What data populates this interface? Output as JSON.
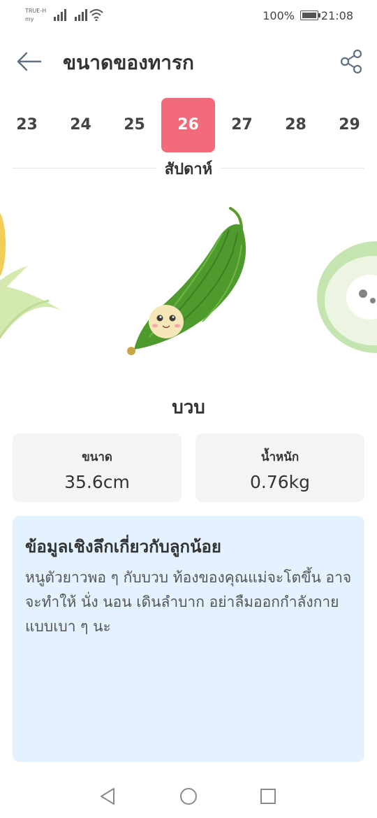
{
  "status_bar": {
    "carrier_line1": "TRUE-H",
    "carrier_line2": "my",
    "battery_text": "100%",
    "time": "21:08"
  },
  "header": {
    "title": "ขนาดของทารก",
    "back_icon": "arrow-left-icon",
    "share_icon": "share-icon"
  },
  "weeks": {
    "items": [
      "23",
      "24",
      "25",
      "26",
      "27",
      "28",
      "29"
    ],
    "selected": "26",
    "unit_label": "สัปดาห์",
    "active_color": "#f36b7a"
  },
  "fruit": {
    "name": "บวบ"
  },
  "stats": {
    "size_label": "ขนาด",
    "size_value": "35.6cm",
    "weight_label": "น้ำหนัก",
    "weight_value": "0.76kg"
  },
  "insight": {
    "title": "ข้อมูลเชิงลึกเกี่ยวกับลูกน้อย",
    "body": "หนูตัวยาวพอ ๆ กับบวบ ท้องของคุณแม่จะโตขึ้น อาจจะทำให้ นั่ง นอน เดินลำบาก อย่าลืมออกกำลังกายแบบเบา ๆ นะ",
    "background": "#e3f2fe"
  },
  "nav": {
    "back_icon": "triangle-back-icon",
    "home_icon": "circle-home-icon",
    "recents_icon": "square-recents-icon"
  }
}
